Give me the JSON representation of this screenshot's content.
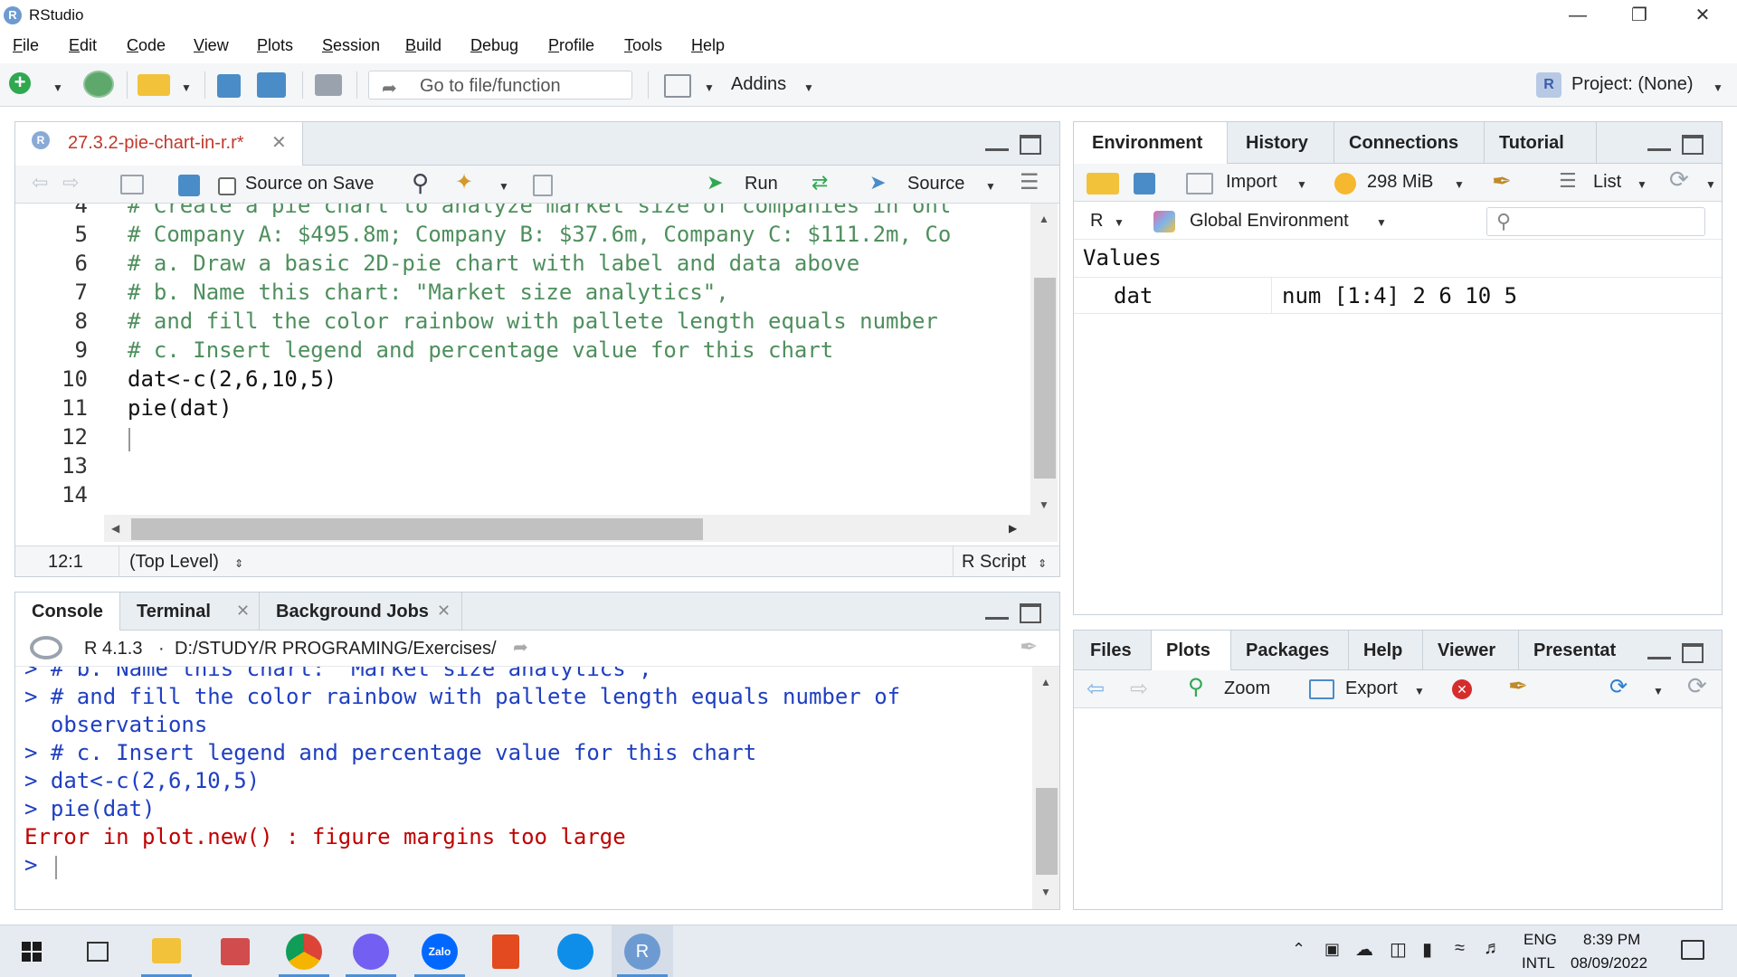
{
  "window": {
    "app_name": "RStudio",
    "icon_letter": "R"
  },
  "menu": [
    "File",
    "Edit",
    "Code",
    "View",
    "Plots",
    "Session",
    "Build",
    "Debug",
    "Profile",
    "Tools",
    "Help"
  ],
  "toolbar": {
    "goto_placeholder": "Go to file/function",
    "addins_label": "Addins",
    "project_label": "Project: (None)"
  },
  "editor": {
    "tab_label": "27.3.2-pie-chart-in-r.r*",
    "source_on_save": "Source on Save",
    "run_label": "Run",
    "source_label": "Source",
    "lines": [
      {
        "n": "4",
        "text": "# Create a pie chart to analyze market size of companies in onl",
        "type": "comment"
      },
      {
        "n": "5",
        "text": "# Company A: $495.8m; Company B: $37.6m, Company C: $111.2m, Co",
        "type": "comment"
      },
      {
        "n": "6",
        "text": "# a. Draw a basic 2D-pie chart with label and data above",
        "type": "comment"
      },
      {
        "n": "7",
        "text": "# b. Name this chart: \"Market size analytics\",",
        "type": "comment"
      },
      {
        "n": "8",
        "text": "# and fill the color rainbow with pallete length equals number",
        "type": "comment"
      },
      {
        "n": "9",
        "text": "# c. Insert legend and percentage value for this chart",
        "type": "comment"
      },
      {
        "n": "10",
        "text": "dat<-c(2,6,10,5)",
        "type": "code"
      },
      {
        "n": "11",
        "text": "pie(dat)",
        "type": "code"
      },
      {
        "n": "12",
        "text": "",
        "type": "code"
      },
      {
        "n": "13",
        "text": "",
        "type": "code"
      },
      {
        "n": "14",
        "text": "",
        "type": "code"
      }
    ],
    "status_position": "12:1",
    "status_scope": "(Top Level)",
    "status_type": "R Script"
  },
  "console": {
    "tabs": [
      "Console",
      "Terminal",
      "Background Jobs"
    ],
    "version": "R 4.1.3",
    "path": "D:/STUDY/R PROGRAMING/Exercises/",
    "lines": [
      {
        "text": "> # b. Name this chart: \"Market size analytics\",",
        "type": "input"
      },
      {
        "text": "> # and fill the color rainbow with pallete length equals number of",
        "type": "input"
      },
      {
        "text": "  observations",
        "type": "input"
      },
      {
        "text": "> # c. Insert legend and percentage value for this chart",
        "type": "input"
      },
      {
        "text": "> dat<-c(2,6,10,5)",
        "type": "input"
      },
      {
        "text": "> pie(dat)",
        "type": "input"
      },
      {
        "text": "Error in plot.new() : figure margins too large",
        "type": "error"
      },
      {
        "text": "> ",
        "type": "input"
      }
    ]
  },
  "environment": {
    "tabs": [
      "Environment",
      "History",
      "Connections",
      "Tutorial"
    ],
    "import_label": "Import",
    "memory_label": "298 MiB",
    "list_label": "List",
    "r_label": "R",
    "scope_label": "Global Environment",
    "section": "Values",
    "var_name": "dat",
    "var_value": "num [1:4] 2 6 10 5"
  },
  "files": {
    "tabs": [
      "Files",
      "Plots",
      "Packages",
      "Help",
      "Viewer",
      "Presentat"
    ],
    "zoom_label": "Zoom",
    "export_label": "Export"
  },
  "taskbar": {
    "lang_top": "ENG",
    "lang_bottom": "INTL",
    "time": "8:39 PM",
    "date": "08/09/2022",
    "zalo": "Zalo"
  },
  "colors": {
    "accent": "#4a90d9",
    "comment": "#4e8f5d",
    "number": "#2c44b3",
    "console_input": "#1f3fc1",
    "error": "#c00000"
  }
}
